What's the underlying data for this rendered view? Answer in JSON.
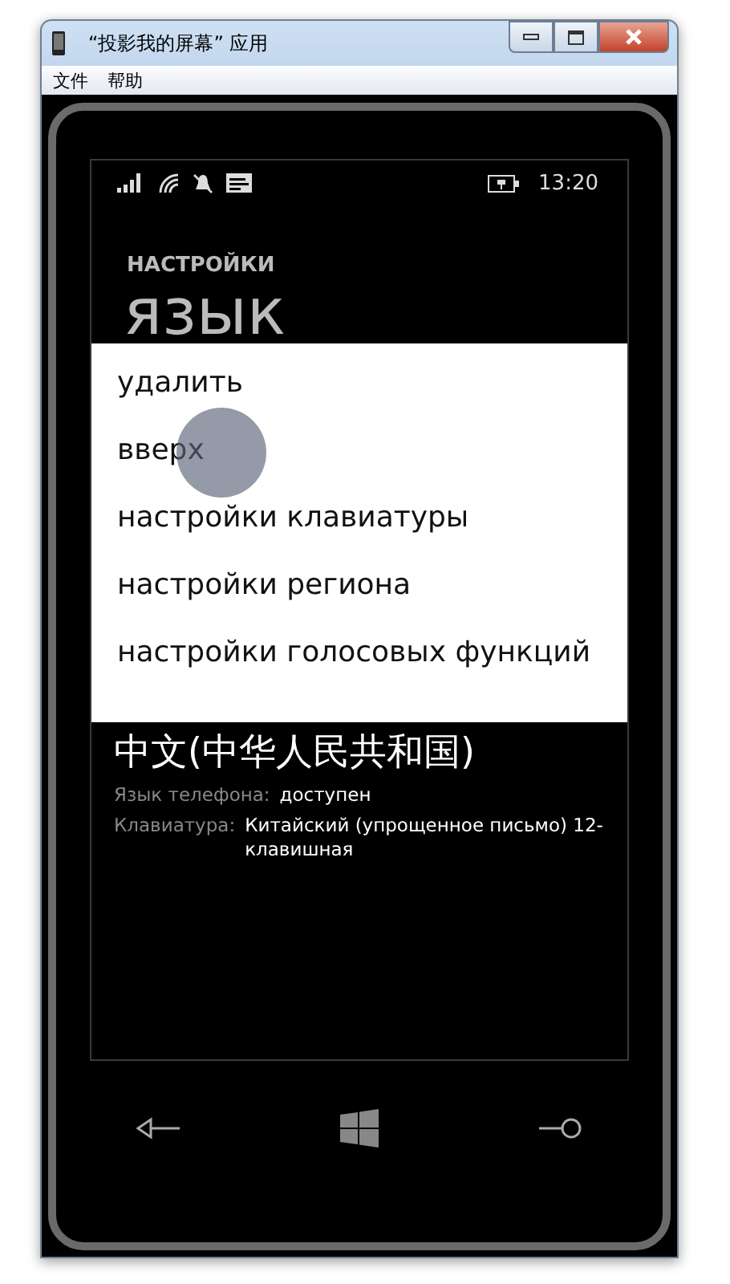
{
  "window": {
    "title": "“投影我的屏幕” 应用"
  },
  "menu": [
    "文件",
    "帮助"
  ],
  "status_bar": {
    "time": "13:20"
  },
  "page": {
    "header": "НАСТРОЙКИ",
    "title": "язык"
  },
  "context_menu": {
    "items": [
      {
        "label": "удалить"
      },
      {
        "label": "вверх"
      },
      {
        "label": "настройки клавиатуры"
      },
      {
        "label": "настройки региона"
      },
      {
        "label": "настройки голосовых функций"
      }
    ]
  },
  "language": {
    "name": "中文(中华人民共和国)",
    "details": [
      {
        "label": "Язык телефона:",
        "value": "доступен"
      },
      {
        "label": "Клавиатура:",
        "value": "Китайский (упрощенное письмо) 12-клавишная"
      }
    ]
  }
}
